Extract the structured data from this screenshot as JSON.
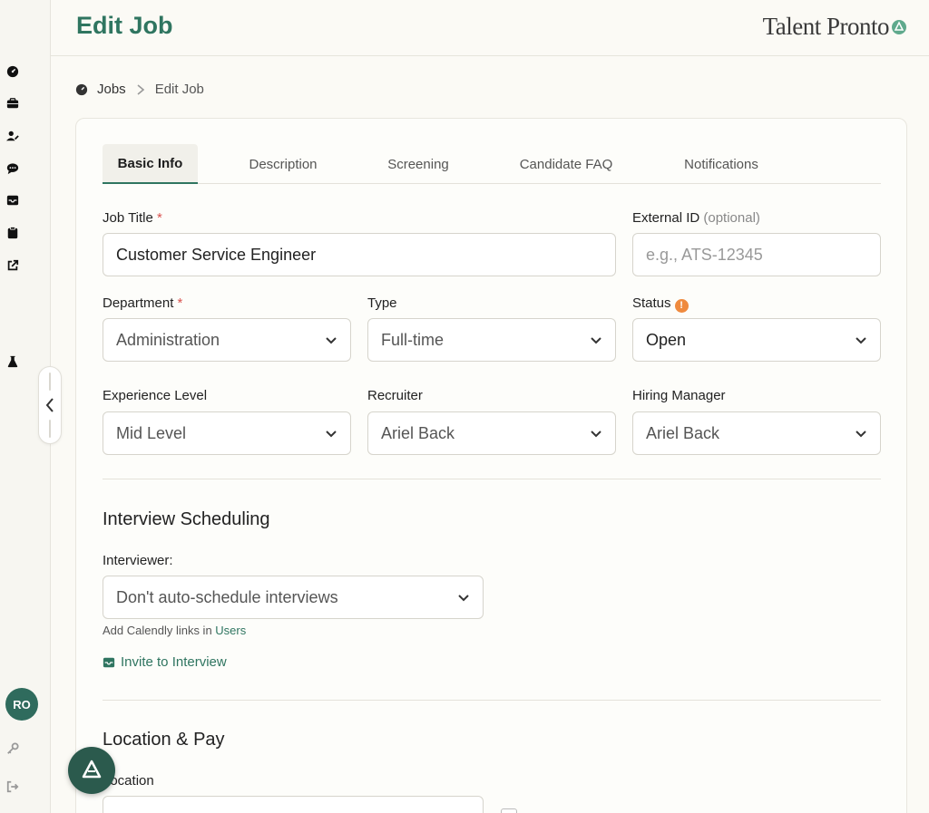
{
  "header": {
    "title": "Edit Job",
    "brand": "Talent Pronto"
  },
  "sidebar": {
    "icons": [
      "dashboard-icon",
      "briefcase-icon",
      "user-edit-icon",
      "chat-icon",
      "inbox-icon",
      "clipboard-icon",
      "external-link-icon",
      "flask-icon"
    ],
    "avatar_initials": "RO"
  },
  "breadcrumb": {
    "root": "Jobs",
    "current": "Edit Job"
  },
  "tabs": [
    {
      "label": "Basic Info",
      "active": true
    },
    {
      "label": "Description",
      "active": false
    },
    {
      "label": "Screening",
      "active": false
    },
    {
      "label": "Candidate FAQ",
      "active": false
    },
    {
      "label": "Notifications",
      "active": false
    }
  ],
  "form": {
    "job_title": {
      "label": "Job Title",
      "required": "*",
      "value": "Customer Service Engineer"
    },
    "external_id": {
      "label": "External ID",
      "optional": "(optional)",
      "placeholder": "e.g., ATS-12345"
    },
    "department": {
      "label": "Department",
      "required": "*",
      "value": "Administration"
    },
    "type": {
      "label": "Type",
      "value": "Full-time"
    },
    "status": {
      "label": "Status",
      "badge": "!",
      "value": "Open"
    },
    "experience_level": {
      "label": "Experience Level",
      "value": "Mid Level"
    },
    "recruiter": {
      "label": "Recruiter",
      "value": "Ariel Back"
    },
    "hiring_manager": {
      "label": "Hiring Manager",
      "value": "Ariel Back"
    }
  },
  "interview": {
    "title": "Interview Scheduling",
    "interviewer_label": "Interviewer:",
    "interviewer_value": "Don't auto-schedule interviews",
    "help_prefix": "Add Calendly links in ",
    "help_link": "Users",
    "invite_label": "Invite to Interview"
  },
  "location_pay": {
    "title": "Location & Pay",
    "location_label": "Location"
  },
  "colors": {
    "accent": "#2f7560",
    "avatar": "#2f6b5d",
    "warning": "#ef8a3e"
  }
}
